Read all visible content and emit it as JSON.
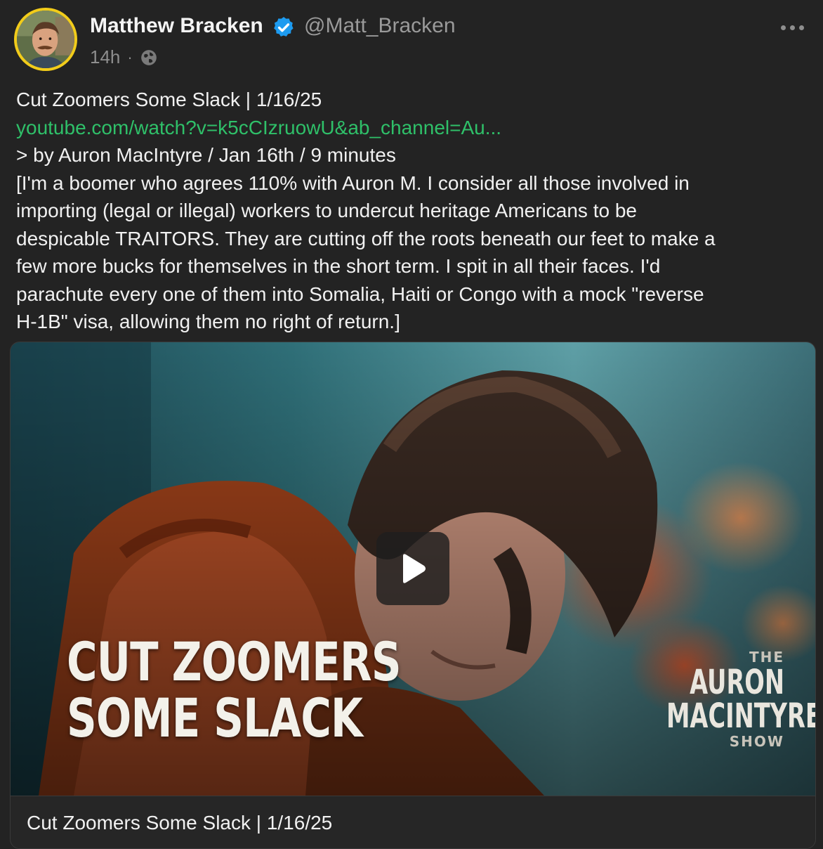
{
  "post": {
    "author_name": "Matthew Bracken",
    "handle": "@Matt_Bracken",
    "time": "14h",
    "separator": "·",
    "verified_icon": "verified-badge-icon",
    "globe_icon": "globe-icon",
    "more_icon": "more-options-icon",
    "lines": [
      "Cut Zoomers Some Slack | 1/16/25",
      "youtube.com/watch?v=k5cCIzruowU&ab_channel=Au...",
      "> by Auron MacIntyre / Jan 16th / 9 minutes",
      "[I'm a boomer who agrees 110% with Auron M. I consider all those involved in",
      "importing (legal or illegal) workers to undercut heritage Americans to be",
      "despicable TRAITORS. They are cutting off the roots beneath our feet to make a",
      "few more bucks for themselves in the short term. I spit in all their faces. I'd",
      "parachute every one of them into Somalia, Haiti or Congo with a mock \"reverse",
      "H-1B\" visa, allowing them no right of return.]"
    ]
  },
  "media": {
    "thumbnail_title_line1": "CUT ZOOMERS",
    "thumbnail_title_line2": "SOME SLACK",
    "logo_the": "THE",
    "logo_auron": "AURON",
    "logo_macintyre": "MACINTYRE",
    "logo_show": "SHOW",
    "play_icon": "play-icon",
    "caption": "Cut Zoomers Some Slack | 1/16/25"
  },
  "colors": {
    "background": "#232323",
    "link": "#2fc069",
    "verified": "#1d9bf0",
    "avatar_ring": "#f2cc1a",
    "muted": "#8e8e8e"
  }
}
